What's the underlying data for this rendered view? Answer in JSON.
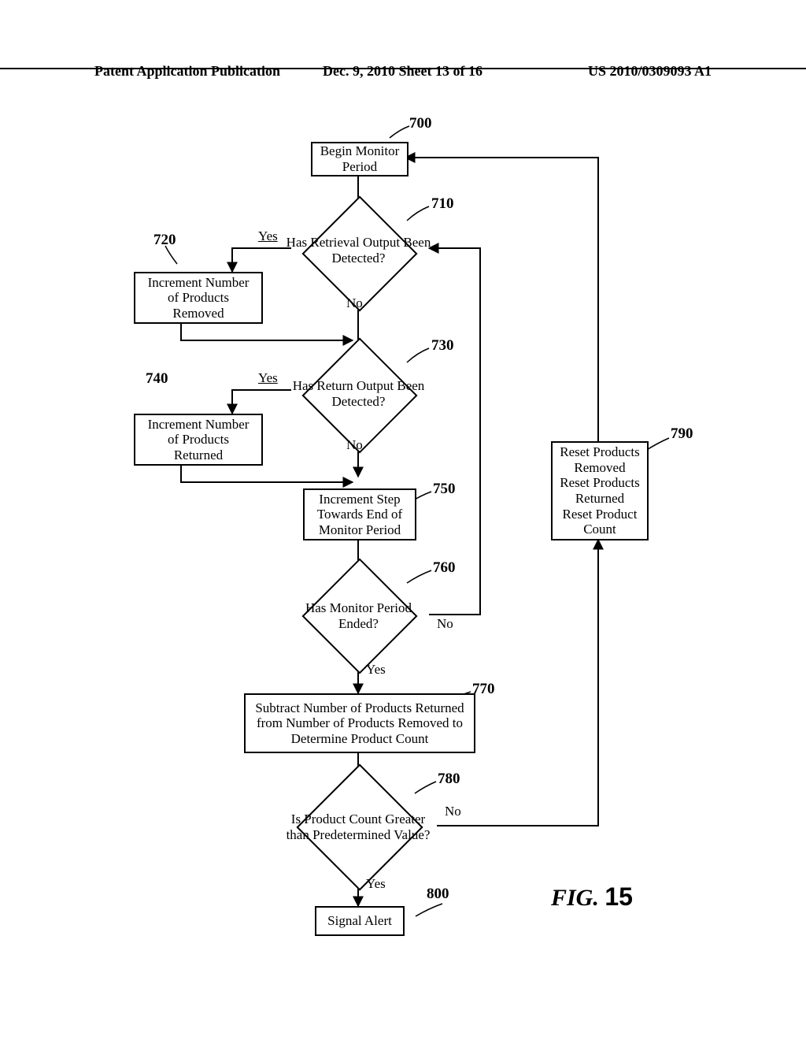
{
  "header": {
    "left": "Patent Application Publication",
    "center": "Dec. 9, 2010  Sheet 13 of 16",
    "right": "US 2010/0309093 A1"
  },
  "figure_label_prefix": "FIG. ",
  "figure_label_number": "15",
  "nodes": {
    "n700": {
      "text": "Begin Monitor\nPeriod",
      "ref": "700"
    },
    "n710": {
      "text": "Has Retrieval Output\nBeen Detected?",
      "ref": "710"
    },
    "n720": {
      "text": "Increment Number\nof Products\nRemoved",
      "ref": "720"
    },
    "n730": {
      "text": "Has Return Output Been\nDetected?",
      "ref": "730"
    },
    "n740": {
      "text": "Increment Number\nof Products\nReturned",
      "ref": "740"
    },
    "n750": {
      "text": "Increment Step\nTowards End of\nMonitor Period",
      "ref": "750"
    },
    "n760": {
      "text": "Has Monitor Period\nEnded?",
      "ref": "760"
    },
    "n770": {
      "text": "Subtract Number of Products Returned\nfrom Number of Products Removed to\nDetermine Product Count",
      "ref": "770"
    },
    "n780": {
      "text": "Is Product Count Greater\nthan Predetermined Value?",
      "ref": "780"
    },
    "n790": {
      "text": "Reset Products\nRemoved\nReset Products\nReturned\nReset Product\nCount",
      "ref": "790"
    },
    "n800": {
      "text": "Signal Alert",
      "ref": "800"
    }
  },
  "edge_labels": {
    "yes": "Yes",
    "no": "No"
  },
  "chart_data": {
    "type": "flowchart",
    "nodes": [
      {
        "id": "700",
        "kind": "process",
        "label": "Begin Monitor Period"
      },
      {
        "id": "710",
        "kind": "decision",
        "label": "Has Retrieval Output Been Detected?"
      },
      {
        "id": "720",
        "kind": "process",
        "label": "Increment Number of Products Removed"
      },
      {
        "id": "730",
        "kind": "decision",
        "label": "Has Return Output Been Detected?"
      },
      {
        "id": "740",
        "kind": "process",
        "label": "Increment Number of Products Returned"
      },
      {
        "id": "750",
        "kind": "process",
        "label": "Increment Step Towards End of Monitor Period"
      },
      {
        "id": "760",
        "kind": "decision",
        "label": "Has Monitor Period Ended?"
      },
      {
        "id": "770",
        "kind": "process",
        "label": "Subtract Number of Products Returned from Number of Products Removed to Determine Product Count"
      },
      {
        "id": "780",
        "kind": "decision",
        "label": "Is Product Count Greater than Predetermined Value?"
      },
      {
        "id": "790",
        "kind": "process",
        "label": "Reset Products Removed / Reset Products Returned / Reset Product Count"
      },
      {
        "id": "800",
        "kind": "process",
        "label": "Signal Alert"
      }
    ],
    "edges": [
      {
        "from": "700",
        "to": "710",
        "label": ""
      },
      {
        "from": "710",
        "to": "720",
        "label": "Yes"
      },
      {
        "from": "710",
        "to": "730",
        "label": "No"
      },
      {
        "from": "720",
        "to": "730",
        "label": ""
      },
      {
        "from": "730",
        "to": "740",
        "label": "Yes"
      },
      {
        "from": "730",
        "to": "750",
        "label": "No"
      },
      {
        "from": "740",
        "to": "750",
        "label": ""
      },
      {
        "from": "750",
        "to": "760",
        "label": ""
      },
      {
        "from": "760",
        "to": "710",
        "label": "No"
      },
      {
        "from": "760",
        "to": "770",
        "label": "Yes"
      },
      {
        "from": "770",
        "to": "780",
        "label": ""
      },
      {
        "from": "780",
        "to": "790",
        "label": "No"
      },
      {
        "from": "780",
        "to": "800",
        "label": "Yes"
      },
      {
        "from": "790",
        "to": "700",
        "label": ""
      }
    ]
  }
}
